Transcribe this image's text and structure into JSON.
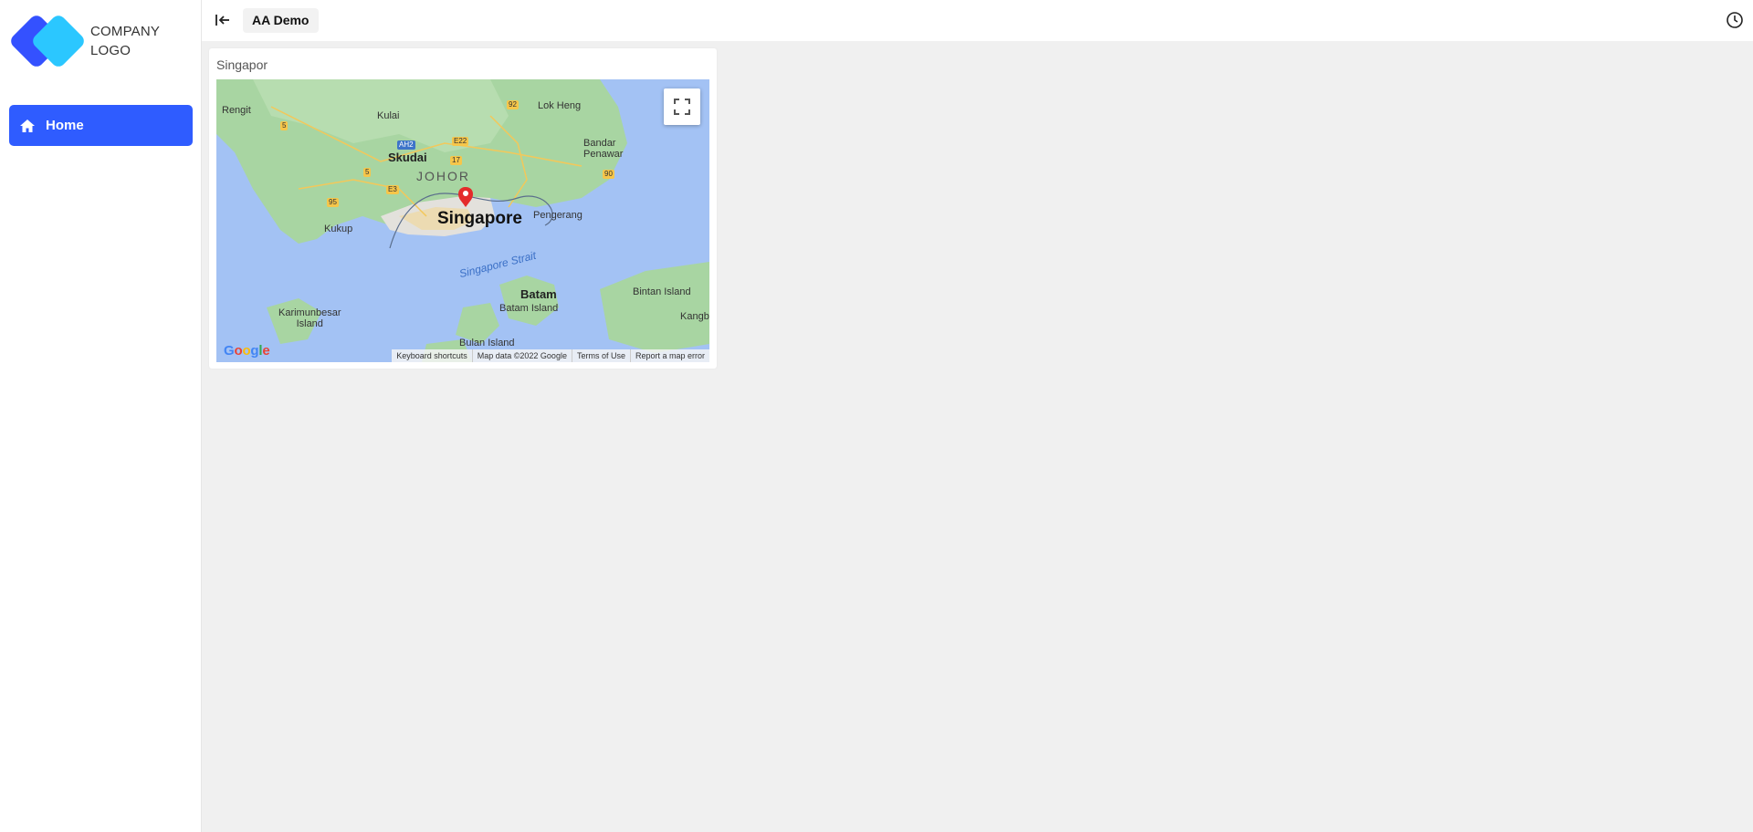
{
  "brand": {
    "logo_line1": "COMPANY",
    "logo_line2": "LOGO",
    "colors": {
      "primary": "#2f5cff",
      "logo_dark": "#3451ff",
      "logo_light": "#2bc7ff"
    }
  },
  "sidebar": {
    "items": [
      {
        "label": "Home",
        "icon": "home-icon",
        "active": true
      }
    ]
  },
  "header": {
    "collapse_icon": "collapse-left-icon",
    "tab_label": "AA Demo",
    "history_icon": "clock-icon"
  },
  "map_card": {
    "title": "Singapor",
    "fullscreen_icon": "fullscreen-icon",
    "google_logo": "Google",
    "attribution": {
      "shortcuts": "Keyboard shortcuts",
      "data": "Map data ©2022 Google",
      "terms": "Terms of Use",
      "report": "Report a map error"
    },
    "labels": {
      "rengit": "Rengit",
      "kulai": "Kulai",
      "lok_heng": "Lok Heng",
      "bandar_penawar": "Bandar\nPenawar",
      "skudai": "Skudai",
      "johor": "JOHOR",
      "singapore": "Singapore",
      "pengerang": "Pengerang",
      "kukup": "Kukup",
      "singapore_strait": "Singapore Strait",
      "karimunbesar": "Karimunbesar\nIsland",
      "batam": "Batam",
      "batam_island": "Batam Island",
      "bintan_island": "Bintan Island",
      "kangb": "Kangb",
      "bulan_island": "Bulan Island"
    },
    "shields": {
      "r5a": "5",
      "r5b": "5",
      "r92": "92",
      "ah2": "AH2",
      "e22": "E22",
      "r17": "17",
      "e3": "E3",
      "r90": "90",
      "r95": "95"
    }
  }
}
